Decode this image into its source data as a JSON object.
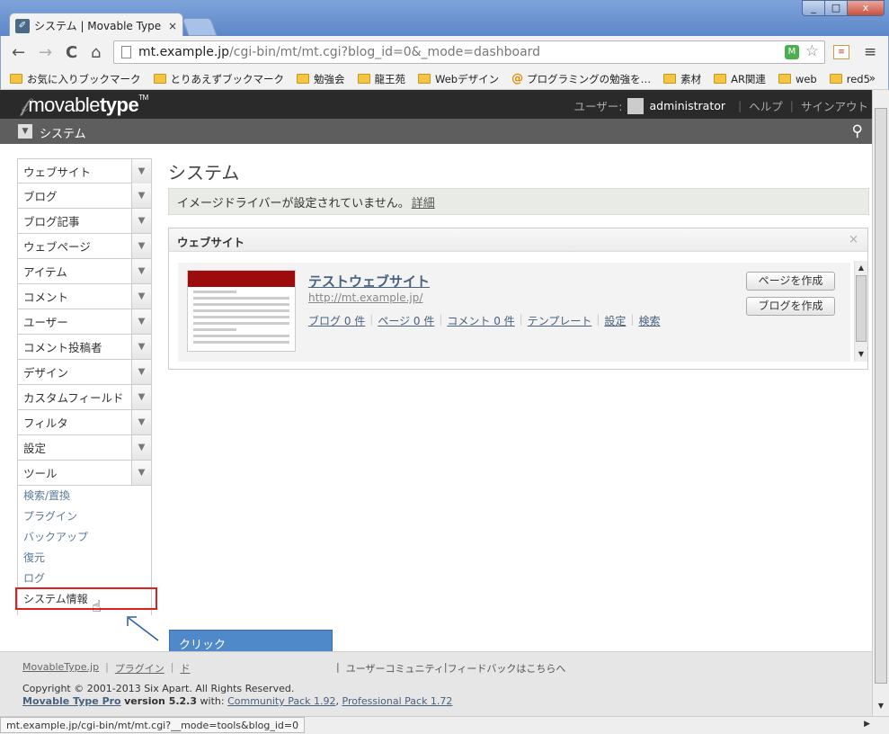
{
  "browser": {
    "tab_title": "システム | Movable Type Pro",
    "tab_close": "×",
    "url_host": "mt.example.jp",
    "url_path": "/cgi-bin/mt/mt.cgi?blog_id=0&_mode=dashboard",
    "window_controls": {
      "min": "_",
      "max": "□",
      "close": "x"
    },
    "nav": {
      "back": "←",
      "forward": "→",
      "reload": "C",
      "home": "⌂"
    },
    "bookmarks": [
      {
        "label": "お気に入りブックマーク",
        "icon": "folder"
      },
      {
        "label": "とりあえずブックマーク",
        "icon": "folder"
      },
      {
        "label": "勉強会",
        "icon": "folder"
      },
      {
        "label": "龍王苑",
        "icon": "folder"
      },
      {
        "label": "Webデザイン",
        "icon": "folder"
      },
      {
        "label": "プログラミングの勉強を…",
        "icon": "at"
      },
      {
        "label": "素材",
        "icon": "folder"
      },
      {
        "label": "AR関連",
        "icon": "folder"
      },
      {
        "label": "web",
        "icon": "folder"
      },
      {
        "label": "red5",
        "icon": "folder"
      }
    ],
    "bookmarks_more": "»",
    "status_url": "mt.example.jp/cgi-bin/mt/mt.cgi?__mode=tools&blog_id=0"
  },
  "header": {
    "logo_light": "movable",
    "logo_bold": "type",
    "logo_tm": "TM",
    "user_label": "ユーザー:",
    "username": "administrator",
    "help": "ヘルプ",
    "signout": "サインアウト",
    "scope": "システム"
  },
  "sidebar": {
    "items": [
      {
        "label": "ウェブサイト"
      },
      {
        "label": "ブログ"
      },
      {
        "label": "ブログ記事"
      },
      {
        "label": "ウェブページ"
      },
      {
        "label": "アイテム"
      },
      {
        "label": "コメント"
      },
      {
        "label": "ユーザー"
      },
      {
        "label": "コメント投稿者"
      },
      {
        "label": "デザイン"
      },
      {
        "label": "カスタムフィールド"
      },
      {
        "label": "フィルタ"
      },
      {
        "label": "設定"
      },
      {
        "label": "ツール"
      }
    ],
    "tools_submenu": [
      "検索/置換",
      "プラグイン",
      "バックアップ",
      "復元",
      "ログ",
      "システム情報"
    ]
  },
  "main": {
    "title": "システム",
    "message": "イメージドライバーが設定されていません。",
    "message_link": "詳細",
    "widget": {
      "title": "ウェブサイト",
      "close": "×",
      "site_name": "テストウェブサイト",
      "site_url": "http://mt.example.jp/",
      "links": [
        "ブログ 0 件",
        "ページ 0 件",
        "コメント 0 件",
        "テンプレート",
        "設定",
        "検索"
      ],
      "btn_create_page": "ページを作成",
      "btn_create_blog": "ブログを作成"
    }
  },
  "annotation": {
    "text": "クリック"
  },
  "footer": {
    "links_left": [
      "MovableType.jp",
      "プラグイン",
      "ド"
    ],
    "links_right": [
      "ユーザーコミュニティ",
      "フィードバックはこちらへ"
    ],
    "copyright": "Copyright © 2001-2013 Six Apart. All Rights Reserved.",
    "product": "Movable Type Pro",
    "version": "version 5.2.3",
    "with": "with:",
    "pack1": "Community Pack 1.92",
    "comma": ",",
    "pack2": "Professional Pack 1.72"
  }
}
